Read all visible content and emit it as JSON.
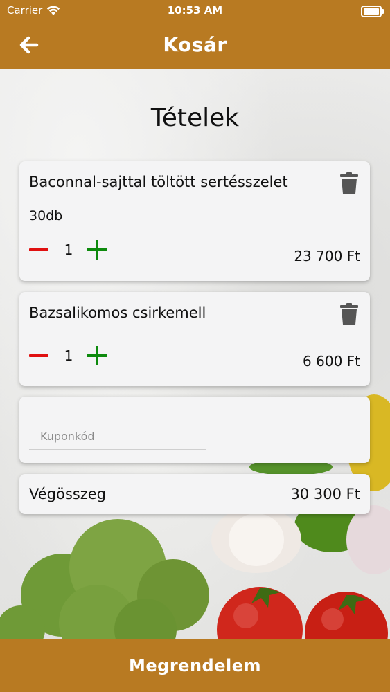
{
  "status_bar": {
    "carrier": "Carrier",
    "time": "10:53 AM"
  },
  "header": {
    "title": "Kosár"
  },
  "section_title": "Tételek",
  "items": [
    {
      "name": "Baconnal-sajttal töltött sertésszelet",
      "subtitle": "30db",
      "quantity": "1",
      "price": "23 700 Ft"
    },
    {
      "name": "Bazsalikomos csirkemell",
      "quantity": "1",
      "price": "6 600 Ft"
    }
  ],
  "coupon": {
    "placeholder": "Kuponkód",
    "value": ""
  },
  "total": {
    "label": "Végösszeg",
    "value": "30 300 Ft"
  },
  "order_button": "Megrendelem",
  "colors": {
    "brand": "#b87a22",
    "minus": "#e01010",
    "plus": "#0d8a0d",
    "card": "#f4f4f5"
  },
  "icons": [
    "wifi-icon",
    "battery-icon",
    "back-arrow-icon",
    "trash-icon",
    "minus-icon",
    "plus-icon"
  ]
}
